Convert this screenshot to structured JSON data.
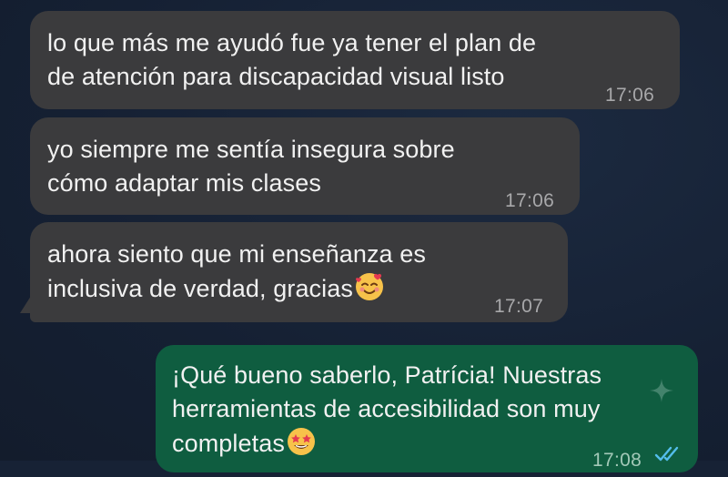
{
  "conversation": {
    "messages": [
      {
        "direction": "incoming",
        "text": "lo que más me ayudó fue ya tener el plan de\nde atención para discapacidad visual listo",
        "time": "17:06"
      },
      {
        "direction": "incoming",
        "text": "yo siempre me sentía insegura sobre\ncómo adaptar mis clases",
        "time": "17:06"
      },
      {
        "direction": "incoming",
        "text": "ahora siento que mi enseñanza es\ninclusiva de verdad, gracias",
        "emoji": "smiling-face-with-hearts-icon",
        "time": "17:07"
      },
      {
        "direction": "outgoing",
        "text": "¡Qué bueno saberlo, Patrícia! Nuestras\nherramientas de accesibilidad son muy\ncompletas",
        "emoji": "star-struck-icon",
        "time": "17:08",
        "status": "read-double-check-icon"
      }
    ]
  },
  "colors": {
    "background": "#172235",
    "incoming_bubble": "#3b3b3d",
    "outgoing_bubble": "#0f5d40",
    "read_ticks": "#53bdeb"
  }
}
